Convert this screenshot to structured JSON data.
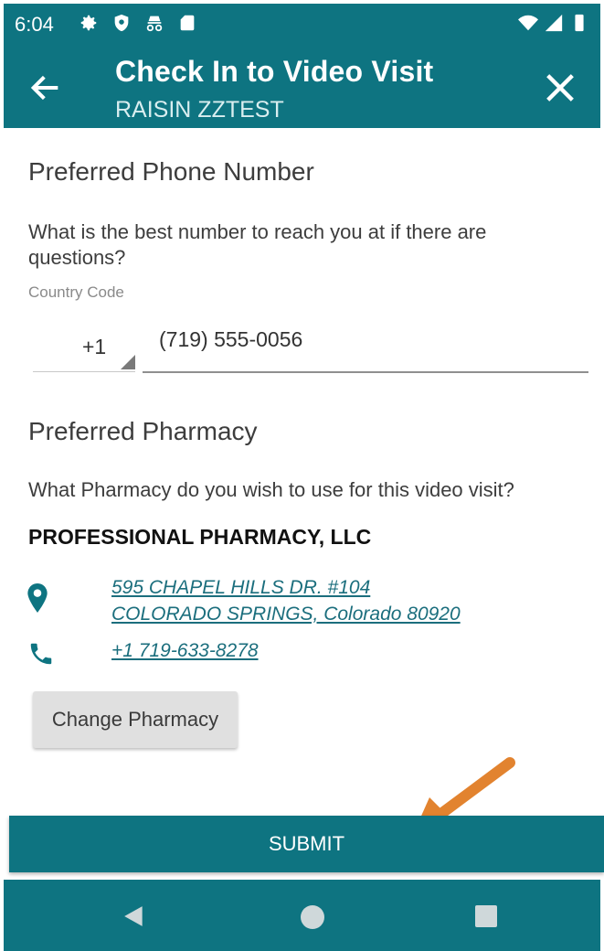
{
  "status_bar": {
    "time": "6:04",
    "left_icons": [
      "settings-icon",
      "shield-icon",
      "incognito-icon",
      "sd-card-icon"
    ],
    "right_icons": [
      "wifi-icon",
      "signal-icon",
      "battery-icon"
    ]
  },
  "app_bar": {
    "title": "Check In to Video Visit",
    "subtitle": "RAISIN ZZTEST",
    "back_icon": "back-arrow-icon",
    "close_icon": "close-icon"
  },
  "phone_section": {
    "heading": "Preferred Phone Number",
    "question": "What is the best number to reach you at if there are questions?",
    "country_code_label": "Country Code",
    "country_code_value": "+1",
    "phone_value": "(719) 555-0056"
  },
  "pharmacy_section": {
    "heading": "Preferred Pharmacy",
    "question": "What Pharmacy do you wish to use for this video visit?",
    "pharmacy_name": "PROFESSIONAL PHARMACY, LLC",
    "address_line1": "595 CHAPEL HILLS DR. #104",
    "address_line2": "COLORADO SPRINGS, Colorado 80920",
    "phone": "+1 719-633-8278",
    "change_button": "Change Pharmacy"
  },
  "submit_button": "SUBMIT",
  "colors": {
    "primary": "#0e7481",
    "link": "#1b6e7d",
    "annotation_arrow": "#e2832f"
  },
  "nav_bar": {
    "icons": [
      "nav-back-icon",
      "nav-home-icon",
      "nav-recents-icon"
    ]
  }
}
